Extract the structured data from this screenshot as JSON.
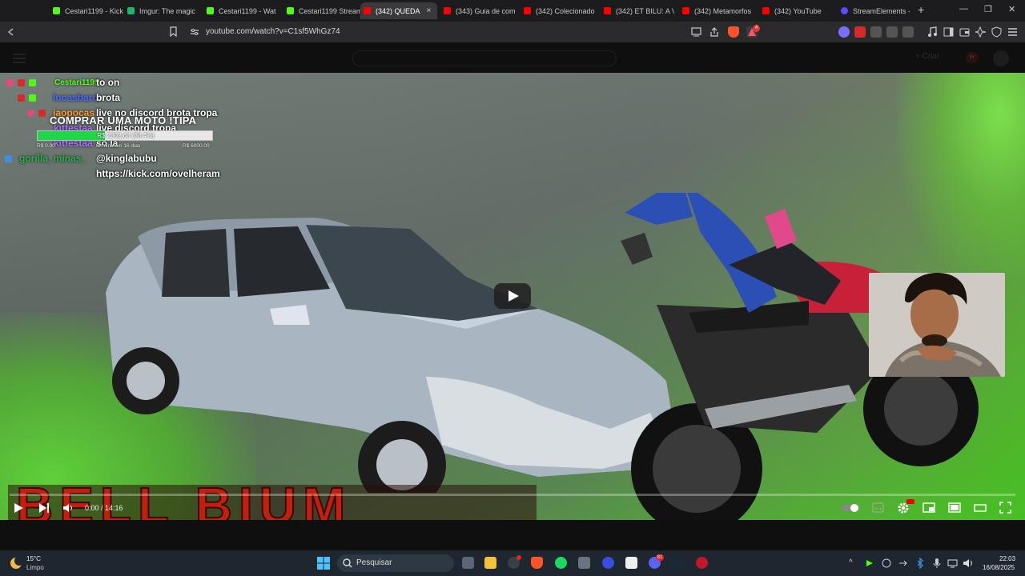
{
  "browser": {
    "tabs": [
      {
        "label": "Cestari1199 - Kick",
        "favicon_color": "#53fc18"
      },
      {
        "label": "Imgur: The magic",
        "favicon_color": "#1bb76e"
      },
      {
        "label": "Cestari1199 - Wat",
        "favicon_color": "#53fc18"
      },
      {
        "label": "Cestari1199 Stream",
        "favicon_color": "#53fc18"
      },
      {
        "label": "(342) QUEDA",
        "favicon_color": "#ff0000",
        "active": true
      },
      {
        "label": "(343) Guia de com",
        "favicon_color": "#ff0000"
      },
      {
        "label": "(342) Colecionado",
        "favicon_color": "#ff0000"
      },
      {
        "label": "(342) ET BILU: A Vi",
        "favicon_color": "#ff0000"
      },
      {
        "label": "(342) Metamorfos",
        "favicon_color": "#ff0000"
      },
      {
        "label": "(342) YouTube",
        "favicon_color": "#ff0000"
      },
      {
        "label": "StreamElements -",
        "favicon_color": "#5b4bff"
      }
    ],
    "new_tab_label": "+",
    "tab_close_label": "×",
    "url": "youtube.com/watch?v=C1sf5WhGz74",
    "window_controls": {
      "minimize": "—",
      "restore": "❐",
      "close": "✕"
    },
    "extension_badge": "4"
  },
  "youtube_header": {
    "create_label": "+ Criar",
    "notification_count": "9+"
  },
  "video": {
    "banner_text": "BELL BIUM",
    "time_display": "0:00 / 14:16",
    "progress_fraction": 0.0
  },
  "chat": {
    "messages": [
      {
        "user": "Cestari1199",
        "user_color": "#53fc18",
        "message": "to on"
      },
      {
        "user": "lucasbaro",
        "user_color": "#4b6bff",
        "message": "brota"
      },
      {
        "user": "jaopocas",
        "user_color": "#ff9a2e",
        "message": "live no discord brota tropa"
      },
      {
        "user": "kitfestaa",
        "user_color": "#9147ff",
        "message": "live discord tropa"
      },
      {
        "user": "kitfestaa",
        "user_color": "#9147ff",
        "message": "só la"
      },
      {
        "user": "gorilla_minas_",
        "user_color": "#2bb24c",
        "message": "@kinglabubu"
      },
      {
        "user": "",
        "user_color": "#2bb24c",
        "message": "https://kick.com/ovelheram"
      }
    ]
  },
  "goal": {
    "title": "COMPRAR UMA MOTO !TIPA",
    "amount_text": "R$ 2302,63 (38.4%)",
    "fraction": 0.384,
    "min_label": "R$ 0.00",
    "ends_label": "termina em 16 dias",
    "max_label": "R$ 6000.00"
  },
  "taskbar": {
    "weather_temp": "15°C",
    "weather_desc": "Limpo",
    "search_placeholder": "Pesquisar",
    "clock_time": "22:03",
    "clock_date": "16/08/2025",
    "discord_badge": "81",
    "hidden_icons": "^"
  }
}
